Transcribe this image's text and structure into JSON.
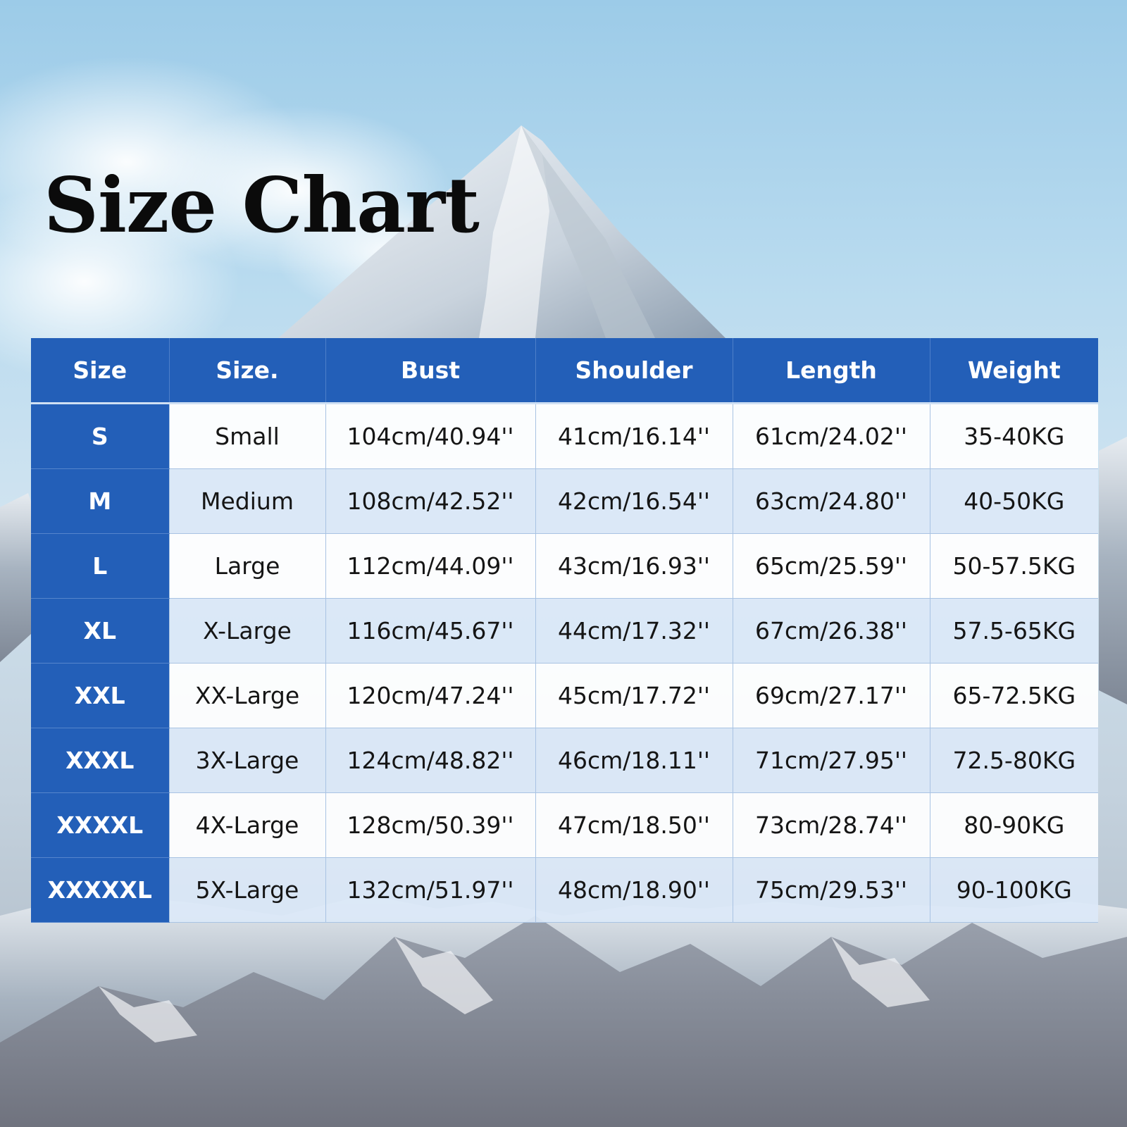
{
  "title": "Size Chart",
  "colors": {
    "header": "#235fb8",
    "row_light": "#ffffff",
    "row_tint": "#dce8f7",
    "title_text": "#0b0b0b"
  },
  "table": {
    "headers": [
      "Size",
      "Size.",
      "Bust",
      "Shoulder",
      "Length",
      "Weight"
    ],
    "rows": [
      [
        "S",
        "Small",
        "104cm/40.94''",
        "41cm/16.14''",
        "61cm/24.02''",
        "35-40KG"
      ],
      [
        "M",
        "Medium",
        "108cm/42.52''",
        "42cm/16.54''",
        "63cm/24.80''",
        "40-50KG"
      ],
      [
        "L",
        "Large",
        "112cm/44.09''",
        "43cm/16.93''",
        "65cm/25.59''",
        "50-57.5KG"
      ],
      [
        "XL",
        "X-Large",
        "116cm/45.67''",
        "44cm/17.32''",
        "67cm/26.38''",
        "57.5-65KG"
      ],
      [
        "XXL",
        "XX-Large",
        "120cm/47.24''",
        "45cm/17.72''",
        "69cm/27.17''",
        "65-72.5KG"
      ],
      [
        "XXXL",
        "3X-Large",
        "124cm/48.82''",
        "46cm/18.11''",
        "71cm/27.95''",
        "72.5-80KG"
      ],
      [
        "XXXXL",
        "4X-Large",
        "128cm/50.39''",
        "47cm/18.50''",
        "73cm/28.74''",
        "80-90KG"
      ],
      [
        "XXXXXL",
        "5X-Large",
        "132cm/51.97''",
        "48cm/18.90''",
        "75cm/29.53''",
        "90-100KG"
      ]
    ]
  }
}
